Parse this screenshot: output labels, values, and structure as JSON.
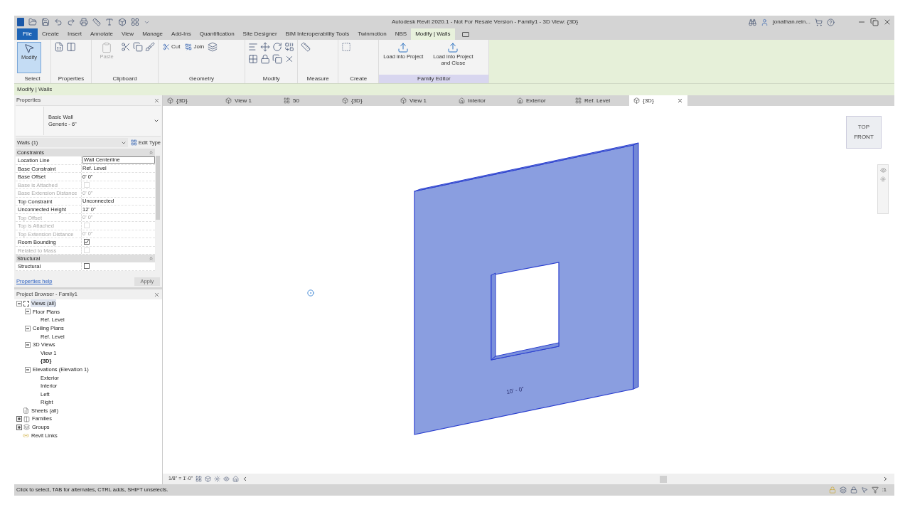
{
  "window": {
    "title": "Autodesk Revit 2020.1 - Not For Resale Version - Family1 - 3D View: {3D}",
    "user": "jonathan.rein..."
  },
  "ribbon_tabs": [
    {
      "label": "File",
      "kind": "file",
      "selected": false
    },
    {
      "label": "Create",
      "kind": "tab",
      "selected": false
    },
    {
      "label": "Insert",
      "kind": "tab",
      "selected": false
    },
    {
      "label": "Annotate",
      "kind": "tab",
      "selected": false
    },
    {
      "label": "View",
      "kind": "tab",
      "selected": false
    },
    {
      "label": "Manage",
      "kind": "tab",
      "selected": false
    },
    {
      "label": "Add-Ins",
      "kind": "tab",
      "selected": false
    },
    {
      "label": "Quantification",
      "kind": "tab",
      "selected": false
    },
    {
      "label": "Site Designer",
      "kind": "tab",
      "selected": false
    },
    {
      "label": "BIM Interoperability Tools",
      "kind": "tab",
      "selected": false
    },
    {
      "label": "Twinmotion",
      "kind": "tab",
      "selected": false
    },
    {
      "label": "NBS",
      "kind": "tab",
      "selected": false
    },
    {
      "label": "Modify | Walls",
      "kind": "tab",
      "selected": true
    }
  ],
  "ribbon_panels": [
    {
      "label": "Select",
      "highlighted": false,
      "tools": [
        {
          "label": "Modify",
          "selected": true,
          "disabled": false
        }
      ]
    },
    {
      "label": "Properties",
      "highlighted": false
    },
    {
      "label": "Clipboard",
      "highlighted": false,
      "tools": [
        {
          "label": "Paste",
          "selected": false,
          "disabled": true
        }
      ]
    },
    {
      "label": "Geometry",
      "highlighted": false,
      "tools": [
        {
          "label": "Cut",
          "selected": false,
          "disabled": false
        },
        {
          "label": "Join",
          "selected": false,
          "disabled": false
        }
      ]
    },
    {
      "label": "Modify",
      "highlighted": false
    },
    {
      "label": "Measure",
      "highlighted": false
    },
    {
      "label": "Create",
      "highlighted": false
    },
    {
      "label": "Family Editor",
      "highlighted": true,
      "tools": [
        {
          "label": "Load into Project",
          "selected": false,
          "disabled": false
        },
        {
          "label": "Load into Project and Close",
          "selected": false,
          "disabled": false
        }
      ]
    }
  ],
  "options_bar": {
    "label": "Modify | Walls"
  },
  "view_tabs": [
    {
      "label": "{3D}",
      "kind": "perspective",
      "selected": false
    },
    {
      "label": "View 1",
      "kind": "perspective",
      "selected": false
    },
    {
      "label": "50",
      "kind": "plan",
      "selected": false
    },
    {
      "label": "{3D}",
      "kind": "perspective",
      "selected": false
    },
    {
      "label": "View 1",
      "kind": "perspective",
      "selected": false
    },
    {
      "label": "Interior",
      "kind": "elevation",
      "selected": false
    },
    {
      "label": "Exterior",
      "kind": "elevation",
      "selected": false
    },
    {
      "label": "Ref. Level",
      "kind": "plan",
      "selected": false
    },
    {
      "label": "{3D}",
      "kind": "perspective",
      "selected": true
    }
  ],
  "properties": {
    "title": "Properties",
    "type_family": "Basic Wall",
    "type_name": "Generic - 6\"",
    "selector": "Walls (1)",
    "edit_type": "Edit Type",
    "groups": [
      {
        "label": "Constraints",
        "rows": [
          {
            "name": "Location Line",
            "kind": "field",
            "value": "Wall Centerline",
            "disabled": false
          },
          {
            "name": "Base Constraint",
            "kind": "text",
            "value": "Ref. Level",
            "disabled": false
          },
          {
            "name": "Base Offset",
            "kind": "text",
            "value": "0'  0\"",
            "disabled": false
          },
          {
            "name": "Base is Attached",
            "kind": "checkbox",
            "checked": false,
            "disabled": true
          },
          {
            "name": "Base Extension Distance",
            "kind": "text",
            "value": "0'  0\"",
            "disabled": true
          },
          {
            "name": "Top Constraint",
            "kind": "text",
            "value": "Unconnected",
            "disabled": false
          },
          {
            "name": "Unconnected Height",
            "kind": "text",
            "value": "12'  0\"",
            "disabled": false
          },
          {
            "name": "Top Offset",
            "kind": "text",
            "value": "0'  0\"",
            "disabled": true
          },
          {
            "name": "Top is Attached",
            "kind": "checkbox",
            "checked": false,
            "disabled": true
          },
          {
            "name": "Top Extension Distance",
            "kind": "text",
            "value": "0'  0\"",
            "disabled": true
          },
          {
            "name": "Room Bounding",
            "kind": "checkbox",
            "checked": true,
            "disabled": false
          },
          {
            "name": "Related to Mass",
            "kind": "checkbox",
            "checked": false,
            "disabled": true
          }
        ]
      },
      {
        "label": "Structural",
        "rows": [
          {
            "name": "Structural",
            "kind": "checkbox",
            "checked": false,
            "disabled": false
          }
        ]
      }
    ],
    "help": "Properties help",
    "apply": "Apply"
  },
  "project_browser": {
    "title": "Project Browser - Family1",
    "tree": [
      {
        "label": "Views (all)",
        "kind": "views",
        "expanded": true,
        "selected": true,
        "children": [
          {
            "label": "Floor Plans",
            "expanded": true,
            "children": [
              {
                "label": "Ref. Level",
                "bold": false
              }
            ]
          },
          {
            "label": "Ceiling Plans",
            "expanded": true,
            "children": [
              {
                "label": "Ref. Level",
                "bold": false
              }
            ]
          },
          {
            "label": "3D Views",
            "expanded": true,
            "children": [
              {
                "label": "View 1",
                "bold": false
              },
              {
                "label": "{3D}",
                "bold": true
              }
            ]
          },
          {
            "label": "Elevations (Elevation 1)",
            "expanded": true,
            "children": [
              {
                "label": "Exterior",
                "bold": false
              },
              {
                "label": "Interior",
                "bold": false
              },
              {
                "label": "Left",
                "bold": false
              },
              {
                "label": "Right",
                "bold": false
              }
            ]
          }
        ]
      },
      {
        "label": "Sheets (all)",
        "kind": "sheets",
        "selected": false
      },
      {
        "label": "Families",
        "kind": "families",
        "expanded": false,
        "selected": false
      },
      {
        "label": "Groups",
        "kind": "groups",
        "expanded": false,
        "selected": false
      },
      {
        "label": "Revit Links",
        "kind": "links",
        "selected": false
      }
    ]
  },
  "canvas": {
    "dimension": "10' - 0\"",
    "viewcube": {
      "top": "TOP",
      "front": "FRONT"
    }
  },
  "view_bar": {
    "scale": "1/8\" = 1'-0\""
  },
  "status_bar": {
    "text": "Click to select, TAB for alternates, CTRL adds, SHIFT unselects.",
    "filter": ":1"
  }
}
